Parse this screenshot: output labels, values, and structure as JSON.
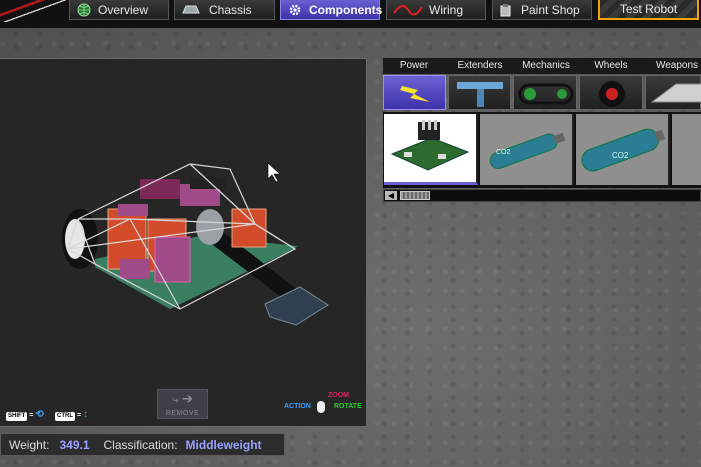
{
  "nav": {
    "overview": "Overview",
    "chassis": "Chassis",
    "components": "Components",
    "wiring": "Wiring",
    "paint_shop": "Paint Shop",
    "test_robot": "Test Robot"
  },
  "categories": [
    "Power",
    "Extenders",
    "Mechanics",
    "Wheels",
    "Weapons"
  ],
  "parts": {
    "co2_text_1": "CO2",
    "co2_text_2": "CO2"
  },
  "controls": {
    "shift_key": "SHIFT",
    "ctrl_key": "CTRL",
    "remove_label": "REMOVE",
    "zoom_label": "ZOOM",
    "action_label": "ACTION",
    "rotate_label": "ROTATE"
  },
  "status": {
    "weight_label": "Weight:",
    "weight_value": "349.1",
    "class_label": "Classification:",
    "class_value": "Middleweight"
  },
  "colors": {
    "accent": "#5b4fc7",
    "hazard": "#f3a300",
    "zoom_color": "#e0205a",
    "action_color": "#3aa0ff",
    "rotate_color": "#22cc22"
  }
}
